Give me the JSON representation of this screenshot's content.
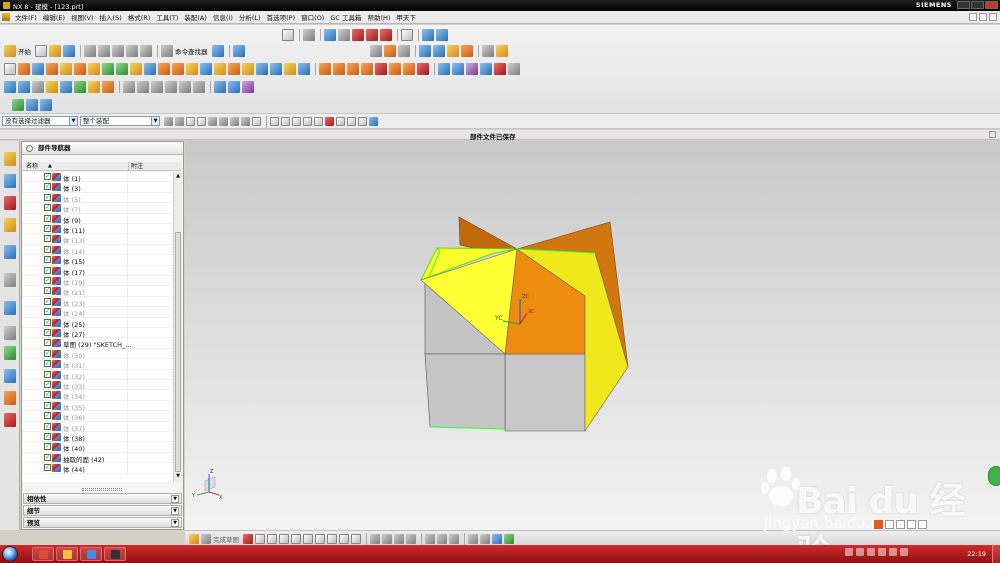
{
  "window": {
    "title": "NX 8 - 建模 - [123.prt]",
    "brand": "SIEMENS"
  },
  "menu": {
    "items": [
      "文件(F)",
      "编辑(E)",
      "视图(V)",
      "插入(S)",
      "格式(R)",
      "工具(T)",
      "装配(A)",
      "信息(I)",
      "分析(L)",
      "首选项(P)",
      "窗口(O)",
      "GC 工具箱",
      "帮助(H)",
      "甲天下"
    ]
  },
  "toolbar": {
    "start_label": "开始",
    "command_finder_label": "命令查找器"
  },
  "filterbar": {
    "selection_filter": "没有选择过滤器",
    "assembly_scope": "整个装配"
  },
  "status": {
    "message": "部件文件已保存"
  },
  "navigator": {
    "title": "部件导航器",
    "columns": {
      "name": "名称",
      "comment": "附注"
    },
    "rows": [
      {
        "label": "体 (1)",
        "hidden": false
      },
      {
        "label": "体 (3)",
        "hidden": false
      },
      {
        "label": "体 (5)",
        "hidden": true
      },
      {
        "label": "体 (7)",
        "hidden": true
      },
      {
        "label": "体 (9)",
        "hidden": false
      },
      {
        "label": "体 (11)",
        "hidden": false
      },
      {
        "label": "体 (13)",
        "hidden": true
      },
      {
        "label": "体 (14)",
        "hidden": true
      },
      {
        "label": "体 (15)",
        "hidden": false
      },
      {
        "label": "体 (17)",
        "hidden": false
      },
      {
        "label": "体 (19)",
        "hidden": true
      },
      {
        "label": "体 (21)",
        "hidden": true
      },
      {
        "label": "体 (23)",
        "hidden": true
      },
      {
        "label": "体 (24)",
        "hidden": true
      },
      {
        "label": "体 (25)",
        "hidden": false
      },
      {
        "label": "体 (27)",
        "hidden": false
      },
      {
        "label": "草图 (29) \"SKETCH_...",
        "hidden": false
      },
      {
        "label": "体 (30)",
        "hidden": true
      },
      {
        "label": "体 (31)",
        "hidden": true
      },
      {
        "label": "体 (32)",
        "hidden": true
      },
      {
        "label": "体 (33)",
        "hidden": true
      },
      {
        "label": "体 (34)",
        "hidden": true
      },
      {
        "label": "体 (35)",
        "hidden": true
      },
      {
        "label": "体 (36)",
        "hidden": true
      },
      {
        "label": "体 (37)",
        "hidden": true
      },
      {
        "label": "体 (38)",
        "hidden": false
      },
      {
        "label": "体 (40)",
        "hidden": false
      },
      {
        "label": "抽取的面 (42)",
        "hidden": false
      },
      {
        "label": "体 (44)",
        "hidden": false
      }
    ],
    "sections": [
      "相依性",
      "细节",
      "预览"
    ]
  },
  "viewport": {
    "axis_labels": {
      "zc": "ZC",
      "yc": "YC",
      "xc": "XC"
    },
    "triad_labels": {
      "y": "Y",
      "x": "X",
      "z": "Z"
    }
  },
  "bottom_toolbar": {
    "sketch_label": "完成草图"
  },
  "taskbar": {
    "clock": "22:19"
  },
  "watermark": {
    "brand": "Bai du 经验",
    "url": "jingyan.baidu.com"
  },
  "colors": {
    "yellow_face": "#ffff33",
    "orange_face": "#e8850f",
    "dark_orange_face": "#c0680a",
    "gray_face": "#c8c8c8",
    "highlight_edge": "#33ff33"
  }
}
